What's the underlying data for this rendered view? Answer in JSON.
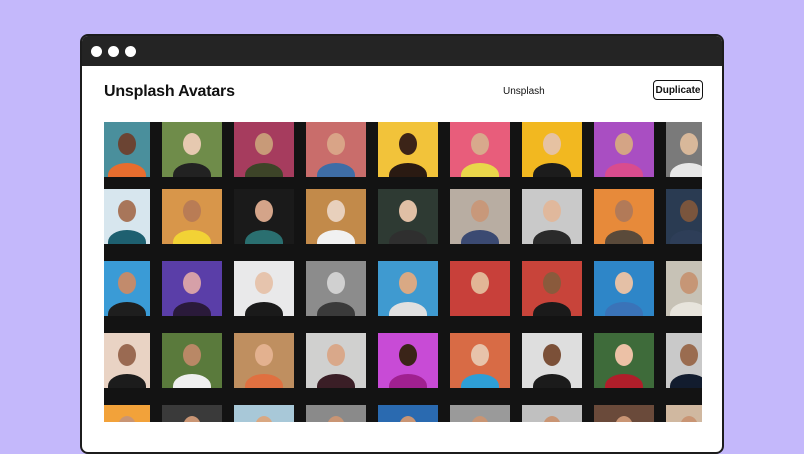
{
  "window": {
    "title_controls": [
      "close",
      "minimize",
      "maximize"
    ]
  },
  "header": {
    "title": "Unsplash Avatars",
    "nav_link": "Unsplash",
    "duplicate_label": "Duplicate"
  },
  "colors": {
    "page_background": "#c4b8fb",
    "titlebar": "#242424",
    "grid_background": "#131313"
  },
  "avatars": [
    [
      {
        "bg": "#4a8f9c",
        "face": "#6b4433",
        "body": "#e76d2e"
      },
      {
        "bg": "#6f8c4a",
        "face": "#e6c9b0",
        "body": "#222222"
      },
      {
        "bg": "#a63c5e",
        "face": "#c89a78",
        "body": "#3d4428"
      },
      {
        "bg": "#c96d6b",
        "face": "#d9a487",
        "body": "#3e6da6"
      },
      {
        "bg": "#f2c33a",
        "face": "#3c2418",
        "body": "#2a1a12"
      },
      {
        "bg": "#e85d7b",
        "face": "#d8a98c",
        "body": "#e9d64a"
      },
      {
        "bg": "#f2b820",
        "face": "#e6c2a2",
        "body": "#1c1c1c"
      },
      {
        "bg": "#a94ec2",
        "face": "#d4a485",
        "body": "#d94c8e"
      },
      {
        "bg": "#7a7a7a",
        "face": "#d8b89a",
        "body": "#e7e7e7"
      }
    ],
    [
      {
        "bg": "#d7e6ee",
        "face": "#a8765a",
        "body": "#1e6070"
      },
      {
        "bg": "#d8964a",
        "face": "#b97c55",
        "body": "#f2d235"
      },
      {
        "bg": "#1a1a1a",
        "face": "#d4a489",
        "body": "#2a6f70"
      },
      {
        "bg": "#c28a4a",
        "face": "#e8d0bc",
        "body": "#f1f1f1"
      },
      {
        "bg": "#2e3a33",
        "face": "#e0bfa5",
        "body": "#2f2f2f"
      },
      {
        "bg": "#b8ada2",
        "face": "#c8987a",
        "body": "#3b4a72"
      },
      {
        "bg": "#c9c9c9",
        "face": "#e0b89c",
        "body": "#2a2a2a"
      },
      {
        "bg": "#e78a3a",
        "face": "#b27a58",
        "body": "#5a4a3a"
      },
      {
        "bg": "#2a3b52",
        "face": "#7a553d",
        "body": "#2e3e58"
      }
    ],
    [
      {
        "bg": "#3a9bd6",
        "face": "#c28b6c",
        "body": "#1e1e1e"
      },
      {
        "bg": "#5a3ea8",
        "face": "#d6a0a8",
        "body": "#2a1a3a"
      },
      {
        "bg": "#e9e9ea",
        "face": "#e6c4ad",
        "body": "#1a1a1a"
      },
      {
        "bg": "#8c8c8c",
        "face": "#d0d0d0",
        "body": "#3a3a3a"
      },
      {
        "bg": "#3f9ad0",
        "face": "#d9a984",
        "body": "#e0e0e0"
      },
      {
        "bg": "#c8403a",
        "face": "#e2b696",
        "body": "#c8403a"
      },
      {
        "bg": "#c8443a",
        "face": "#8a5a3c",
        "body": "#1a1a1a"
      },
      {
        "bg": "#2e86c8",
        "face": "#e4c0a6",
        "body": "#3a73b8"
      },
      {
        "bg": "#c7c2b6",
        "face": "#c69676",
        "body": "#e7e4dc"
      }
    ],
    [
      {
        "bg": "#e9d3c4",
        "face": "#9a6a52",
        "body": "#1c1c1c"
      },
      {
        "bg": "#5a7a3c",
        "face": "#b98866",
        "body": "#efefef"
      },
      {
        "bg": "#bf8f60",
        "face": "#e3b18f",
        "body": "#e07040"
      },
      {
        "bg": "#d0d0cf",
        "face": "#d9a88a",
        "body": "#3a1e26"
      },
      {
        "bg": "#c84bd6",
        "face": "#3a2418",
        "body": "#a02090"
      },
      {
        "bg": "#d86b45",
        "face": "#e7c3aa",
        "body": "#2e9ed6"
      },
      {
        "bg": "#dedede",
        "face": "#7b5038",
        "body": "#1b1b1b"
      },
      {
        "bg": "#3e6b3a",
        "face": "#ecc1a6",
        "body": "#b01e2a"
      },
      {
        "bg": "#c9c9c9",
        "face": "#9a6c50",
        "body": "#121c2e"
      }
    ],
    [
      {
        "bg": "#f2a23a",
        "face": "#c99574",
        "body": "#1a1a1a"
      },
      {
        "bg": "#3a3a3a",
        "face": "#c99574",
        "body": "#2a2a2a"
      },
      {
        "bg": "#a8c8d8",
        "face": "#d9a882",
        "body": "#3a3a3a"
      },
      {
        "bg": "#8a8a8a",
        "face": "#c99574",
        "body": "#2a2a2a"
      },
      {
        "bg": "#2a6ab0",
        "face": "#c99574",
        "body": "#2a2a2a"
      },
      {
        "bg": "#9a9a9a",
        "face": "#c99574",
        "body": "#2a2a2a"
      },
      {
        "bg": "#c0c0c0",
        "face": "#c99574",
        "body": "#2a2a2a"
      },
      {
        "bg": "#6a4a3a",
        "face": "#c99574",
        "body": "#2a2a2a"
      },
      {
        "bg": "#d0b8a0",
        "face": "#c99574",
        "body": "#2a2a2a"
      }
    ]
  ]
}
